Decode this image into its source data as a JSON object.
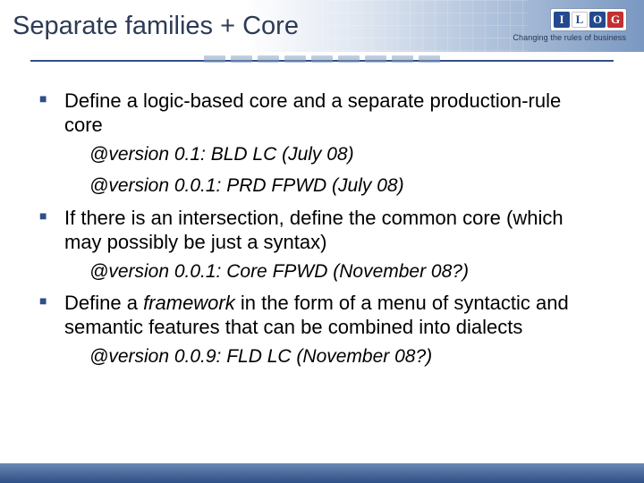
{
  "header": {
    "title": "Separate families + Core"
  },
  "logo": {
    "letters": [
      "I",
      "L",
      "O",
      "G"
    ],
    "tagline": "Changing the rules of business"
  },
  "content": {
    "items": [
      {
        "text_pre": "Define a logic-based core and a separate production-rule core",
        "versions": [
          "@version 0.1: BLD LC (July 08)",
          "@version 0.0.1: PRD FPWD (July 08)"
        ]
      },
      {
        "text_pre": "If there is an intersection, define the common core (which may possibly be just a syntax)",
        "versions": [
          "@version 0.0.1: Core FPWD (November 08?)"
        ]
      },
      {
        "text_pre": "Define a ",
        "text_em": "framework",
        "text_post": " in the form of a menu of syntactic and semantic features that can be combined into dialects",
        "versions": [
          "@version 0.0.9: FLD LC (November 08?)"
        ]
      }
    ]
  }
}
